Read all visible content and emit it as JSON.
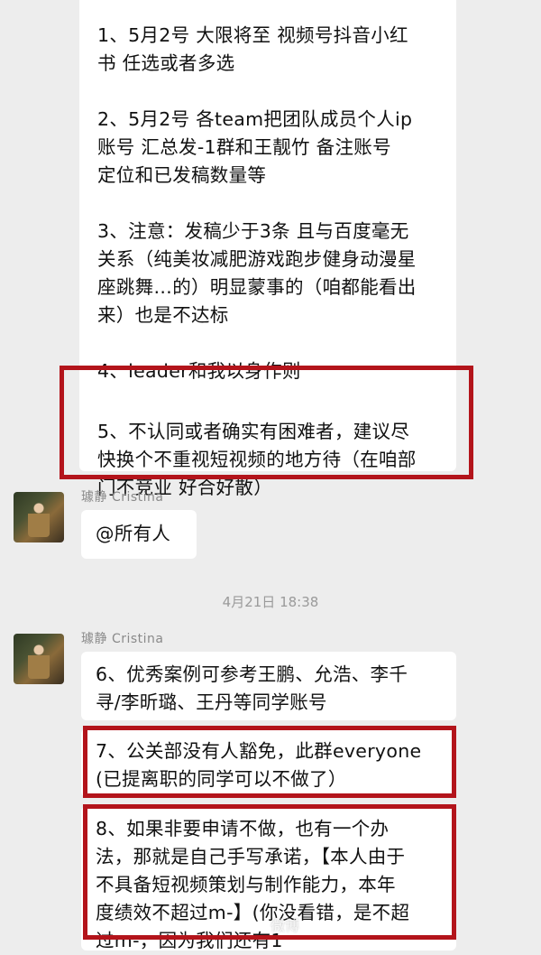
{
  "messages_top": {
    "items": [
      "1、5月2号 大限将至 视频号抖音小红\n书 任选或者多选",
      "2、5月2号 各team把团队成员个人ip\n账号 汇总发-1群和王靓竹 备注账号\n定位和已发稿数量等",
      "3、注意：发稿少于3条 且与百度毫无\n关系（纯美妆减肥游戏跑步健身动漫星\n座跳舞…的）明显蒙事的（咱都能看出\n来）也是不达标",
      "4、leader和我以身作则",
      "5、不认同或者确实有困难者，建议尽\n快换个不重视短视频的地方待（在咱部\n门不竞业 好合好散）"
    ]
  },
  "sender1": {
    "name": "璩静 Cristina"
  },
  "mention": {
    "text": "@所有人"
  },
  "timestamp": {
    "text": "4月21日 18:38"
  },
  "sender2": {
    "name": "璩静 Cristina"
  },
  "messages_bottom": {
    "m6": "6、优秀案例可参考王鹏、允浩、李千\n寻/李昕璐、王丹等同学账号",
    "m7": "7、公关部没有人豁免，此群everyone\n(已提离职的同学可以不做了）",
    "m8": "8、如果非要申请不做，也有一个办\n法，那就是自己手写承诺，【本人由于\n不具备短视频策划与制作能力，本年\n度绩效不超过m-】(你没看错，是不超\n过m-，因为我们还有1"
  },
  "watermark": {
    "text": "微博"
  },
  "colors": {
    "highlight": "#b3141b",
    "background": "#ededed",
    "bubble": "#ffffff"
  }
}
